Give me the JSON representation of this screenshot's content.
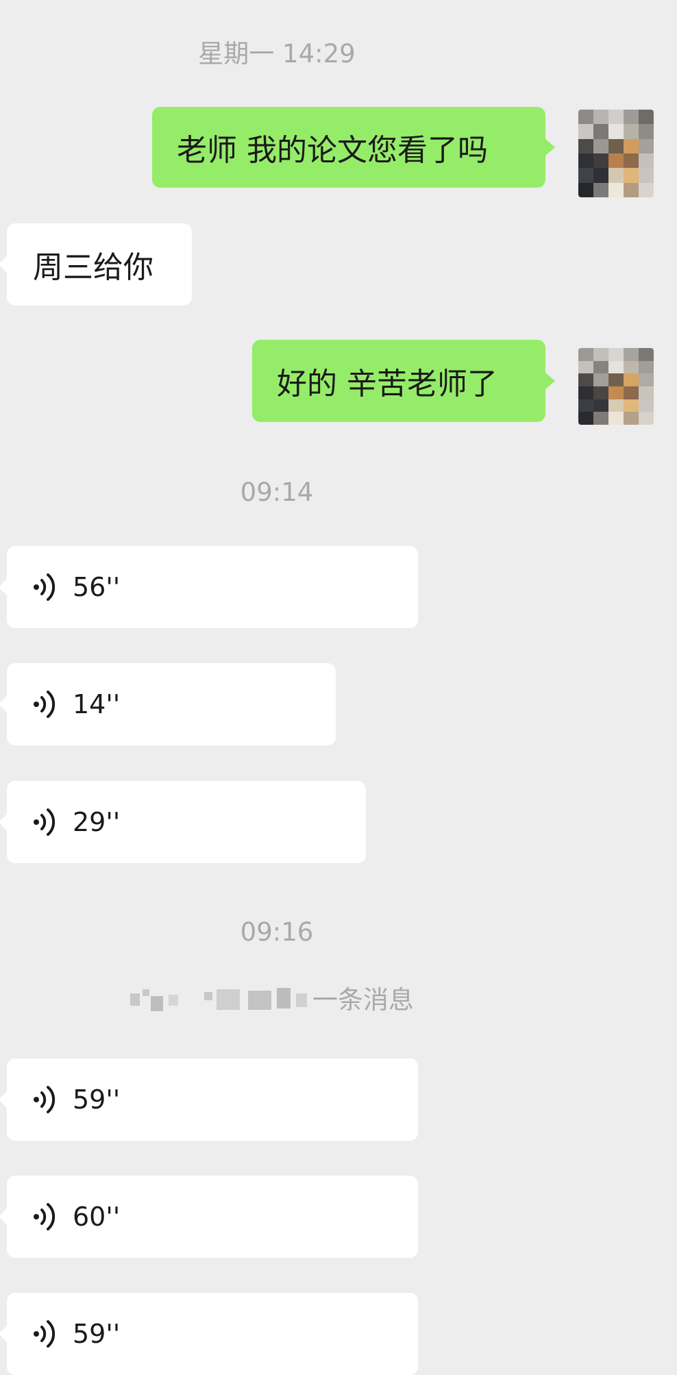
{
  "timestamps": {
    "first": "星期一 14:29",
    "second": "09:14",
    "third": "09:16"
  },
  "messages": {
    "out1": "老师 我的论文您看了吗",
    "in1": "周三给你",
    "out2": "好的 辛苦老师了"
  },
  "voice": [
    {
      "duration": "56''"
    },
    {
      "duration": "14''"
    },
    {
      "duration": "29''"
    },
    {
      "duration": "59''"
    },
    {
      "duration": "60''"
    },
    {
      "duration": "59''"
    }
  ],
  "system_notice": {
    "visible_text": "一条消息"
  },
  "colors": {
    "background": "#ededed",
    "outgoing_bubble": "#95ec69",
    "incoming_bubble": "#ffffff",
    "timestamp_text": "#a9a9a9"
  },
  "icons": {
    "voice": "voice-wave-icon",
    "avatar": "pixelated-avatar"
  }
}
